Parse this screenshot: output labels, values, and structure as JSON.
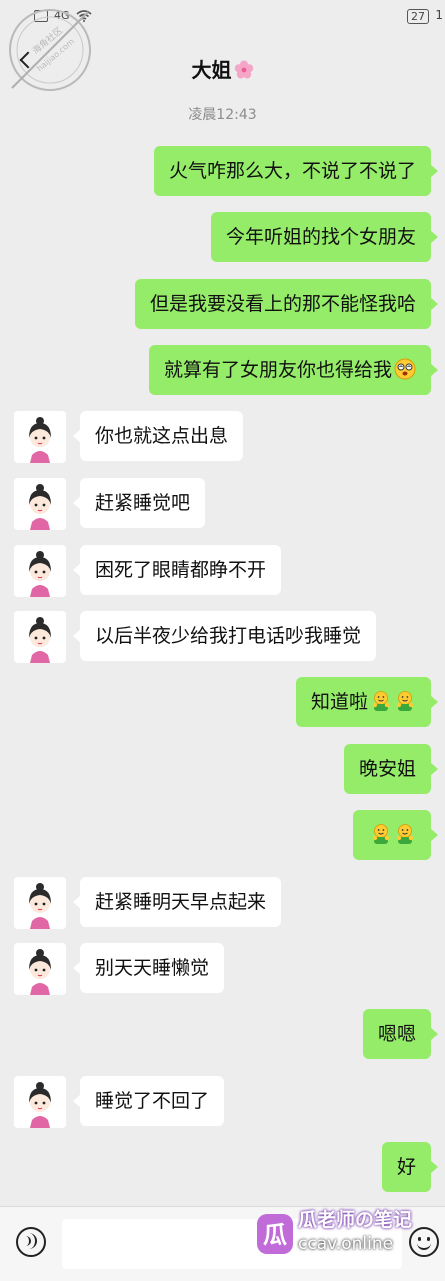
{
  "status_bar": {
    "network": "4G",
    "battery": "27",
    "clock": "1"
  },
  "header": {
    "title": "大姐"
  },
  "timestamp": "凌晨12:43",
  "messages": [
    {
      "from": "me",
      "text": "火气咋那么大，不说了不说了"
    },
    {
      "from": "me",
      "text": "今年听姐的找个女朋友"
    },
    {
      "from": "me",
      "text": "但是我要没看上的那不能怪我哈"
    },
    {
      "from": "me",
      "text": "就算有了女朋友你也得给我",
      "emoji": "dizzy-face-emoji"
    },
    {
      "from": "other",
      "text": "你也就这点出息"
    },
    {
      "from": "other",
      "text": "赶紧睡觉吧"
    },
    {
      "from": "other",
      "text": "困死了眼睛都睁不开"
    },
    {
      "from": "other",
      "text": "以后半夜少给我打电话吵我睡觉"
    },
    {
      "from": "me",
      "text": "知道啦",
      "emoji": "hug-emoji x2"
    },
    {
      "from": "me",
      "text": "晚安姐"
    },
    {
      "from": "me",
      "text": "",
      "emoji": "hug-emoji x2"
    },
    {
      "from": "other",
      "text": "赶紧睡明天早点起来"
    },
    {
      "from": "other",
      "text": "别天天睡懒觉"
    },
    {
      "from": "me",
      "text": "嗯嗯"
    },
    {
      "from": "other",
      "text": "睡觉了不回了"
    },
    {
      "from": "me",
      "text": "好"
    }
  ],
  "input_bar": {
    "placeholder": ""
  },
  "watermark": {
    "brand": "瓜老师の笔记",
    "url": "ccav.online"
  },
  "colors": {
    "background": "#ededed",
    "my_bubble": "#95ec69",
    "other_bubble": "#ffffff",
    "timestamp": "#8c8c8c"
  }
}
